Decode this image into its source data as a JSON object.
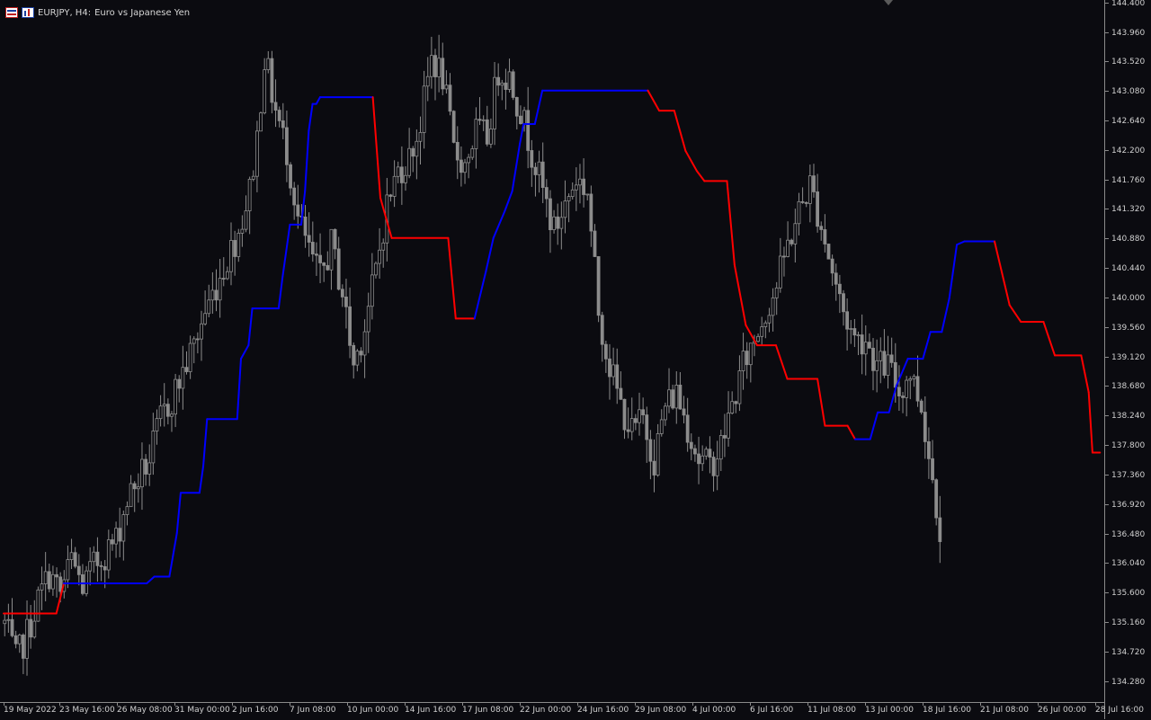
{
  "header": {
    "symbol": "EURJPY, H4:",
    "description": "Euro vs Japanese Yen",
    "icons": [
      "candles-icon",
      "chart-window-icon"
    ]
  },
  "colors": {
    "background": "#0b0b10",
    "candle": "#8c8c8c",
    "line_up": "#0000ff",
    "line_down": "#ff0000",
    "axis_text": "#d0d0d0"
  },
  "chart_data": {
    "type": "line",
    "instrument": "EURJPY",
    "timeframe": "H4",
    "ylim": [
      133.98,
      144.45
    ],
    "y_ticks": [
      "144.400",
      "143.960",
      "143.520",
      "143.080",
      "142.640",
      "142.200",
      "141.760",
      "141.320",
      "140.880",
      "140.440",
      "140.000",
      "139.560",
      "139.120",
      "138.680",
      "138.240",
      "137.800",
      "137.360",
      "136.920",
      "136.480",
      "136.040",
      "135.600",
      "135.160",
      "134.720",
      "134.280"
    ],
    "x_ticks": [
      "19 May 2022",
      "23 May 16:00",
      "26 May 08:00",
      "31 May 00:00",
      "2 Jun 16:00",
      "7 Jun 08:00",
      "10 Jun 00:00",
      "14 Jun 16:00",
      "17 Jun 08:00",
      "22 Jun 00:00",
      "24 Jun 16:00",
      "29 Jun 08:00",
      "4 Jul 00:00",
      "6 Jul 16:00",
      "11 Jul 08:00",
      "13 Jul 00:00",
      "18 Jul 16:00",
      "21 Jul 08:00",
      "26 Jul 00:00",
      "28 Jul 16:00"
    ],
    "close_path": [
      [
        0,
        135.15
      ],
      [
        3,
        134.6
      ],
      [
        6,
        135.0
      ],
      [
        9,
        135.5
      ],
      [
        12,
        135.9
      ],
      [
        15,
        135.6
      ],
      [
        18,
        136.1
      ],
      [
        21,
        135.7
      ],
      [
        24,
        136.0
      ],
      [
        27,
        136.2
      ],
      [
        30,
        136.4
      ],
      [
        33,
        137.0
      ],
      [
        36,
        137.3
      ],
      [
        39,
        137.6
      ],
      [
        42,
        138.2
      ],
      [
        45,
        138.5
      ],
      [
        48,
        138.9
      ],
      [
        51,
        139.3
      ],
      [
        54,
        139.8
      ],
      [
        57,
        140.2
      ],
      [
        60,
        140.6
      ],
      [
        63,
        141.0
      ],
      [
        66,
        141.6
      ],
      [
        68,
        142.4
      ],
      [
        70,
        143.6
      ],
      [
        73,
        142.8
      ],
      [
        76,
        142.2
      ],
      [
        79,
        141.2
      ],
      [
        82,
        140.7
      ],
      [
        85,
        140.3
      ],
      [
        88,
        140.8
      ],
      [
        91,
        140.1
      ],
      [
        94,
        139.0
      ],
      [
        97,
        139.6
      ],
      [
        100,
        140.4
      ],
      [
        103,
        141.4
      ],
      [
        106,
        141.9
      ],
      [
        109,
        142.1
      ],
      [
        112,
        142.6
      ],
      [
        115,
        143.6
      ],
      [
        118,
        143.3
      ],
      [
        121,
        142.2
      ],
      [
        124,
        142.0
      ],
      [
        127,
        142.5
      ],
      [
        130,
        142.4
      ],
      [
        133,
        143.4
      ],
      [
        136,
        143.3
      ],
      [
        139,
        142.8
      ],
      [
        142,
        142.2
      ],
      [
        145,
        141.6
      ],
      [
        148,
        141.0
      ],
      [
        151,
        141.4
      ],
      [
        154,
        141.8
      ],
      [
        157,
        141.6
      ],
      [
        160,
        139.8
      ],
      [
        163,
        139.0
      ],
      [
        166,
        138.4
      ],
      [
        169,
        138.0
      ],
      [
        172,
        138.2
      ],
      [
        175,
        137.6
      ],
      [
        178,
        138.4
      ],
      [
        181,
        138.6
      ],
      [
        184,
        138.1
      ],
      [
        187,
        137.6
      ],
      [
        190,
        137.5
      ],
      [
        193,
        137.8
      ],
      [
        196,
        138.4
      ],
      [
        199,
        139.0
      ],
      [
        202,
        139.4
      ],
      [
        205,
        139.8
      ],
      [
        208,
        140.2
      ],
      [
        211,
        140.8
      ],
      [
        214,
        141.3
      ],
      [
        217,
        141.7
      ],
      [
        220,
        141.1
      ],
      [
        223,
        140.4
      ],
      [
        226,
        139.8
      ],
      [
        229,
        139.4
      ],
      [
        232,
        139.4
      ],
      [
        235,
        139.0
      ],
      [
        238,
        139.0
      ],
      [
        241,
        138.6
      ],
      [
        244,
        138.9
      ],
      [
        247,
        138.4
      ],
      [
        250,
        137.3
      ],
      [
        252,
        136.6
      ]
    ],
    "series": [
      {
        "values": [
          [
            0,
            135.3,
            "down"
          ],
          [
            14,
            135.3,
            "down"
          ],
          [
            16,
            135.75,
            "up"
          ],
          [
            38,
            135.75,
            "up"
          ],
          [
            40,
            135.85,
            "up"
          ],
          [
            44,
            135.85,
            "up"
          ],
          [
            46,
            136.5,
            "up"
          ],
          [
            47,
            137.1,
            "up"
          ],
          [
            52,
            137.1,
            "up"
          ],
          [
            53,
            137.5,
            "up"
          ],
          [
            54,
            138.2,
            "up"
          ],
          [
            62,
            138.2,
            "up"
          ],
          [
            63,
            139.1,
            "up"
          ],
          [
            65,
            139.3,
            "up"
          ],
          [
            66,
            139.85,
            "up"
          ],
          [
            73,
            139.85,
            "up"
          ],
          [
            74,
            140.3,
            "up"
          ],
          [
            76,
            141.1,
            "up"
          ],
          [
            79,
            141.1,
            "up"
          ],
          [
            80,
            141.6,
            "up"
          ],
          [
            81,
            142.5,
            "up"
          ],
          [
            82,
            142.9,
            "up"
          ],
          [
            83,
            142.9,
            "up"
          ],
          [
            84,
            143.0,
            "up"
          ],
          [
            98,
            143.0,
            "down"
          ],
          [
            100,
            141.5,
            "down"
          ],
          [
            103,
            140.9,
            "down"
          ],
          [
            118,
            140.9,
            "down"
          ],
          [
            120,
            139.7,
            "down"
          ],
          [
            125,
            139.7,
            "up"
          ],
          [
            128,
            140.4,
            "up"
          ],
          [
            130,
            140.9,
            "up"
          ],
          [
            133,
            141.3,
            "up"
          ],
          [
            135,
            141.6,
            "up"
          ],
          [
            137,
            142.3,
            "up"
          ],
          [
            138,
            142.6,
            "up"
          ],
          [
            141,
            142.6,
            "up"
          ],
          [
            143,
            143.1,
            "up"
          ],
          [
            171,
            143.1,
            "down"
          ],
          [
            174,
            142.8,
            "down"
          ],
          [
            178,
            142.8,
            "down"
          ],
          [
            181,
            142.2,
            "down"
          ],
          [
            184,
            141.9,
            "down"
          ],
          [
            186,
            141.75,
            "down"
          ],
          [
            192,
            141.75,
            "down"
          ],
          [
            194,
            140.5,
            "down"
          ],
          [
            197,
            139.6,
            "down"
          ],
          [
            200,
            139.3,
            "down"
          ],
          [
            205,
            139.3,
            "down"
          ],
          [
            208,
            138.8,
            "down"
          ],
          [
            216,
            138.8,
            "down"
          ],
          [
            218,
            138.1,
            "down"
          ],
          [
            224,
            138.1,
            "down"
          ],
          [
            226,
            137.9,
            "up"
          ],
          [
            230,
            137.9,
            "up"
          ],
          [
            232,
            138.3,
            "up"
          ],
          [
            235,
            138.3,
            "up"
          ],
          [
            237,
            138.7,
            "up"
          ],
          [
            240,
            139.1,
            "up"
          ],
          [
            244,
            139.1,
            "up"
          ],
          [
            246,
            139.5,
            "up"
          ],
          [
            249,
            139.5,
            "up"
          ],
          [
            251,
            140.0,
            "up"
          ],
          [
            253,
            140.8,
            "up"
          ],
          [
            255,
            140.85,
            "up"
          ],
          [
            263,
            140.85,
            "down"
          ],
          [
            267,
            139.9,
            "down"
          ],
          [
            270,
            139.65,
            "down"
          ],
          [
            276,
            139.65,
            "down"
          ],
          [
            279,
            139.15,
            "down"
          ],
          [
            286,
            139.15,
            "down"
          ],
          [
            288,
            138.6,
            "down"
          ],
          [
            289,
            137.7,
            "down"
          ],
          [
            291,
            137.7,
            "down"
          ]
        ]
      }
    ]
  }
}
